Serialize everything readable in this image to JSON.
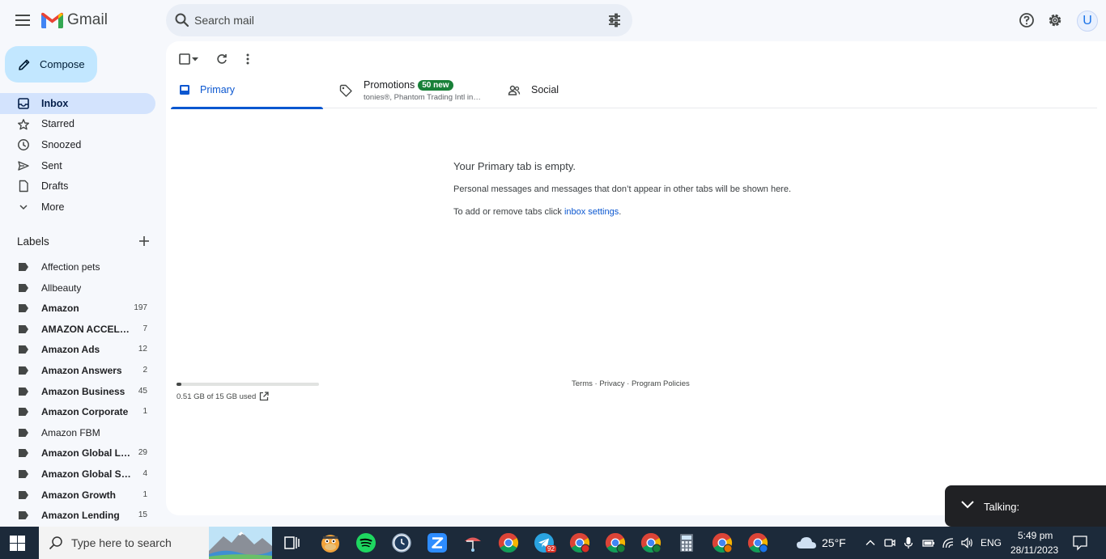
{
  "app": {
    "title": "Gmail",
    "search_placeholder": "Search mail",
    "avatar_letter": "U"
  },
  "compose_label": "Compose",
  "nav": [
    {
      "label": "Inbox",
      "active": true,
      "icon": "inbox-icon"
    },
    {
      "label": "Starred",
      "active": false,
      "icon": "star-icon"
    },
    {
      "label": "Snoozed",
      "active": false,
      "icon": "clock-icon"
    },
    {
      "label": "Sent",
      "active": false,
      "icon": "send-icon"
    },
    {
      "label": "Drafts",
      "active": false,
      "icon": "draft-icon"
    },
    {
      "label": "More",
      "active": false,
      "icon": "chevron-down-icon"
    }
  ],
  "labels_heading": "Labels",
  "labels": [
    {
      "name": "Affection pets",
      "count": "",
      "bold": false
    },
    {
      "name": "Allbeauty",
      "count": "",
      "bold": false
    },
    {
      "name": "Amazon",
      "count": "197",
      "bold": true
    },
    {
      "name": "AMAZON ACCELER…",
      "count": "7",
      "bold": true
    },
    {
      "name": "Amazon Ads",
      "count": "12",
      "bold": true
    },
    {
      "name": "Amazon Answers",
      "count": "2",
      "bold": true
    },
    {
      "name": "Amazon Business",
      "count": "45",
      "bold": true
    },
    {
      "name": "Amazon Corporate",
      "count": "1",
      "bold": true
    },
    {
      "name": "Amazon FBM",
      "count": "",
      "bold": false
    },
    {
      "name": "Amazon Global Lo…",
      "count": "29",
      "bold": true
    },
    {
      "name": "Amazon Global Sell…",
      "count": "4",
      "bold": true
    },
    {
      "name": "Amazon Growth",
      "count": "1",
      "bold": true
    },
    {
      "name": "Amazon Lending",
      "count": "15",
      "bold": true
    }
  ],
  "tabs": {
    "primary": "Primary",
    "promotions": "Promotions",
    "promotions_badge": "50 new",
    "promotions_snippet": "tonies®, Phantom Trading Intl in…",
    "social": "Social"
  },
  "empty": {
    "title": "Your Primary tab is empty.",
    "line1": "Personal messages and messages that don’t appear in other tabs will be shown here.",
    "line2_prefix": "To add or remove tabs click ",
    "line2_link": "inbox settings",
    "line2_suffix": "."
  },
  "storage": {
    "text": "0.51 GB of 15 GB used",
    "fraction": 0.034
  },
  "footer": {
    "terms": "Terms",
    "privacy": "Privacy",
    "policies": "Program Policies",
    "sep": " · "
  },
  "talking_label": "Talking:",
  "taskbar": {
    "search_placeholder": "Type here to search",
    "weather": "25°F",
    "language": "ENG",
    "time": "5:49 pm",
    "date": "28/11/2023",
    "telegram_badge": "92",
    "apps": [
      "task-view-icon",
      "game-app-icon",
      "spotify-icon",
      "clock-app-icon",
      "zoom-icon",
      "network-app-icon",
      "chrome-icon",
      "telegram-icon",
      "chrome-icon",
      "chrome-icon",
      "chrome-icon",
      "calculator-icon",
      "chrome-icon",
      "chrome-icon"
    ]
  },
  "colors": {
    "accent": "#0b57d0",
    "compose_bg": "#c2e7ff",
    "active_nav_bg": "#d3e3fd",
    "badge_green": "#188038",
    "taskbar_bg": "#1c2a3a"
  }
}
